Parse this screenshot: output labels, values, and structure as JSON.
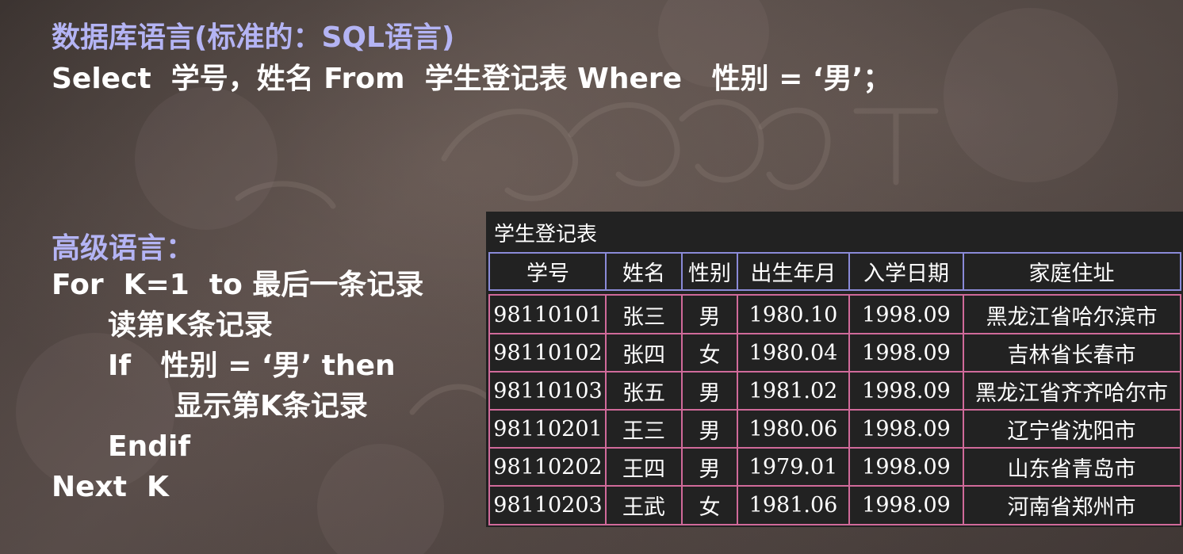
{
  "slide": {
    "sql_heading": "数据库语言(标准的：SQL语言)",
    "sql_statement": "Select  学号，姓名 From  学生登记表 Where   性别 = ‘男’；",
    "high_level_heading": "高级语言：",
    "code_lines": [
      "For  K=1  to 最后一条记录",
      "读第K条记录",
      "If   性别 = ‘男’ then",
      "显示第K条记录",
      "Endif",
      "Next  K"
    ]
  },
  "table": {
    "title": "学生登记表",
    "columns": [
      "学号",
      "姓名",
      "性别",
      "出生年月",
      "入学日期",
      "家庭住址"
    ],
    "rows": [
      [
        "98110101",
        "张三",
        "男",
        "1980.10",
        "1998.09",
        "黑龙江省哈尔滨市"
      ],
      [
        "98110102",
        "张四",
        "女",
        "1980.04",
        "1998.09",
        "吉林省长春市"
      ],
      [
        "98110103",
        "张五",
        "男",
        "1981.02",
        "1998.09",
        "黑龙江省齐齐哈尔市"
      ],
      [
        "98110201",
        "王三",
        "男",
        "1980.06",
        "1998.09",
        "辽宁省沈阳市"
      ],
      [
        "98110202",
        "王四",
        "男",
        "1979.01",
        "1998.09",
        "山东省青岛市"
      ],
      [
        "98110203",
        "王武",
        "女",
        "1981.06",
        "1998.09",
        "河南省郑州市"
      ]
    ]
  },
  "colors": {
    "heading_accent": "#b4b4f4",
    "body_text": "#ffffff",
    "table_background": "#222222",
    "header_border": "#8a8ad8",
    "body_border": "#d06a9a"
  }
}
